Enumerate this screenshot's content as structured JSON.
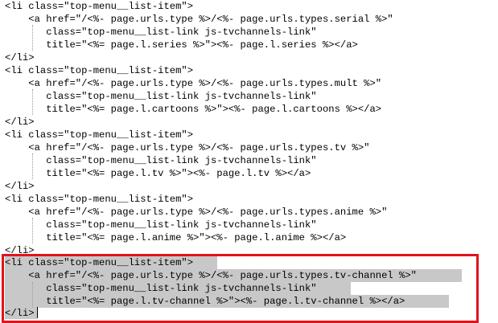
{
  "code_lines": [
    "<li class=\"top-menu__list-item\">",
    "    <a href=\"/<%- page.urls.type %>/<%- page.urls.types.serial %>\"",
    "       class=\"top-menu__list-link js-tvchannels-link\"",
    "       title=\"<%= page.l.series %>\"><%- page.l.series %></a>",
    "</li>",
    "<li class=\"top-menu__list-item\">",
    "    <a href=\"/<%- page.urls.type %>/<%- page.urls.types.mult %>\"",
    "       class=\"top-menu__list-link js-tvchannels-link\"",
    "       title=\"<%= page.l.cartoons %>\"><%- page.l.cartoons %></a>",
    "</li>",
    "<li class=\"top-menu__list-item\">",
    "    <a href=\"/<%- page.urls.type %>/<%- page.urls.types.tv %>\"",
    "       class=\"top-menu__list-link js-tvchannels-link\"",
    "       title=\"<%= page.l.tv %>\"><%- page.l.tv %></a>",
    "</li>",
    "<li class=\"top-menu__list-item\">",
    "    <a href=\"/<%- page.urls.type %>/<%- page.urls.types.anime %>\"",
    "       class=\"top-menu__list-link js-tvchannels-link\"",
    "       title=\"<%= page.l.anime %>\"><%- page.l.anime %></a>",
    "</li>",
    "<li class=\"top-menu__list-item\">",
    "    <a href=\"/<%- page.urls.type %>/<%- page.urls.types.tv-channel %>\"",
    "       class=\"top-menu__list-link js-tvchannels-link\"",
    "       title=\"<%= page.l.tv-channel %>\"><%- page.l.tv-channel %></a>",
    "</li>"
  ],
  "selected_lines": [
    20,
    21,
    22,
    23,
    24
  ],
  "colors": {
    "selection": "#c8c8c8",
    "highlight_border": "#e0141c",
    "text": "#000000",
    "background": "#ffffff"
  }
}
